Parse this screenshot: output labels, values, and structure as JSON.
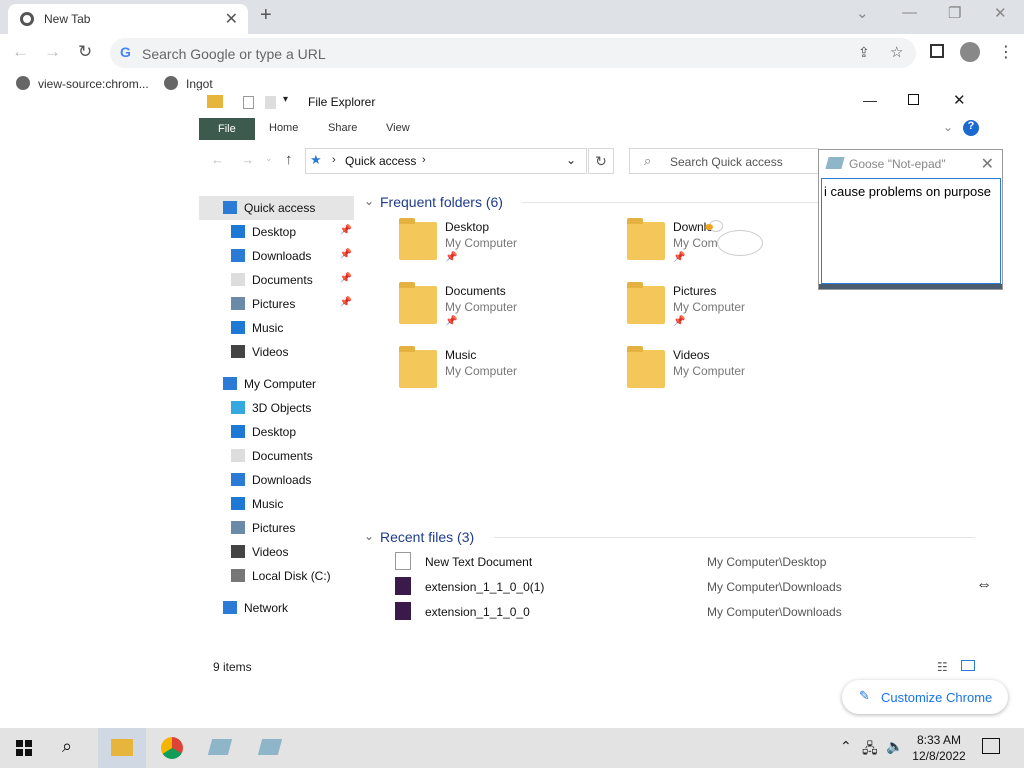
{
  "browser": {
    "tab_title": "New Tab",
    "omnibox_placeholder": "Search Google or type a URL",
    "bookmarks": [
      "view-source:chrom...",
      "Ingot"
    ],
    "customize_label": "Customize Chrome"
  },
  "explorer": {
    "title": "File Explorer",
    "ribbon_tabs": {
      "file": "File",
      "home": "Home",
      "share": "Share",
      "view": "View"
    },
    "address": "Quick access",
    "search_placeholder": "Search Quick access",
    "nav": [
      {
        "label": "Quick access",
        "icon": "star-icon"
      },
      {
        "label": "Desktop",
        "icon": "desktop-icon",
        "pinned": true
      },
      {
        "label": "Downloads",
        "icon": "download-icon",
        "pinned": true
      },
      {
        "label": "Documents",
        "icon": "document-icon",
        "pinned": true
      },
      {
        "label": "Pictures",
        "icon": "picture-icon",
        "pinned": true
      },
      {
        "label": "Music",
        "icon": "music-icon"
      },
      {
        "label": "Videos",
        "icon": "video-icon"
      },
      {
        "label": "My Computer",
        "icon": "computer-icon"
      },
      {
        "label": "3D Objects",
        "icon": "cube-icon"
      },
      {
        "label": "Desktop",
        "icon": "desktop-icon"
      },
      {
        "label": "Documents",
        "icon": "document-icon"
      },
      {
        "label": "Downloads",
        "icon": "download-icon"
      },
      {
        "label": "Music",
        "icon": "music-icon"
      },
      {
        "label": "Pictures",
        "icon": "picture-icon"
      },
      {
        "label": "Videos",
        "icon": "video-icon"
      },
      {
        "label": "Local Disk (C:)",
        "icon": "drive-icon"
      },
      {
        "label": "Network",
        "icon": "network-icon"
      }
    ],
    "frequent_header": "Frequent folders (6)",
    "folders": [
      {
        "name": "Desktop",
        "location": "My Computer"
      },
      {
        "name": "Downlo",
        "location": "My Com"
      },
      {
        "name": "Documents",
        "location": "My Computer"
      },
      {
        "name": "Pictures",
        "location": "My Computer"
      },
      {
        "name": "Music",
        "location": "My Computer"
      },
      {
        "name": "Videos",
        "location": "My Computer"
      }
    ],
    "recent_header": "Recent files (3)",
    "recent": [
      {
        "name": "New Text Document",
        "location": "My Computer\\Desktop"
      },
      {
        "name": "extension_1_1_0_0(1)",
        "location": "My Computer\\Downloads"
      },
      {
        "name": "extension_1_1_0_0",
        "location": "My Computer\\Downloads"
      }
    ],
    "status": "9 items"
  },
  "notepad": {
    "title": "Goose \"Not-epad\"",
    "text": "i cause problems on purpose"
  },
  "taskbar": {
    "time": "8:33 AM",
    "date": "12/8/2022"
  }
}
